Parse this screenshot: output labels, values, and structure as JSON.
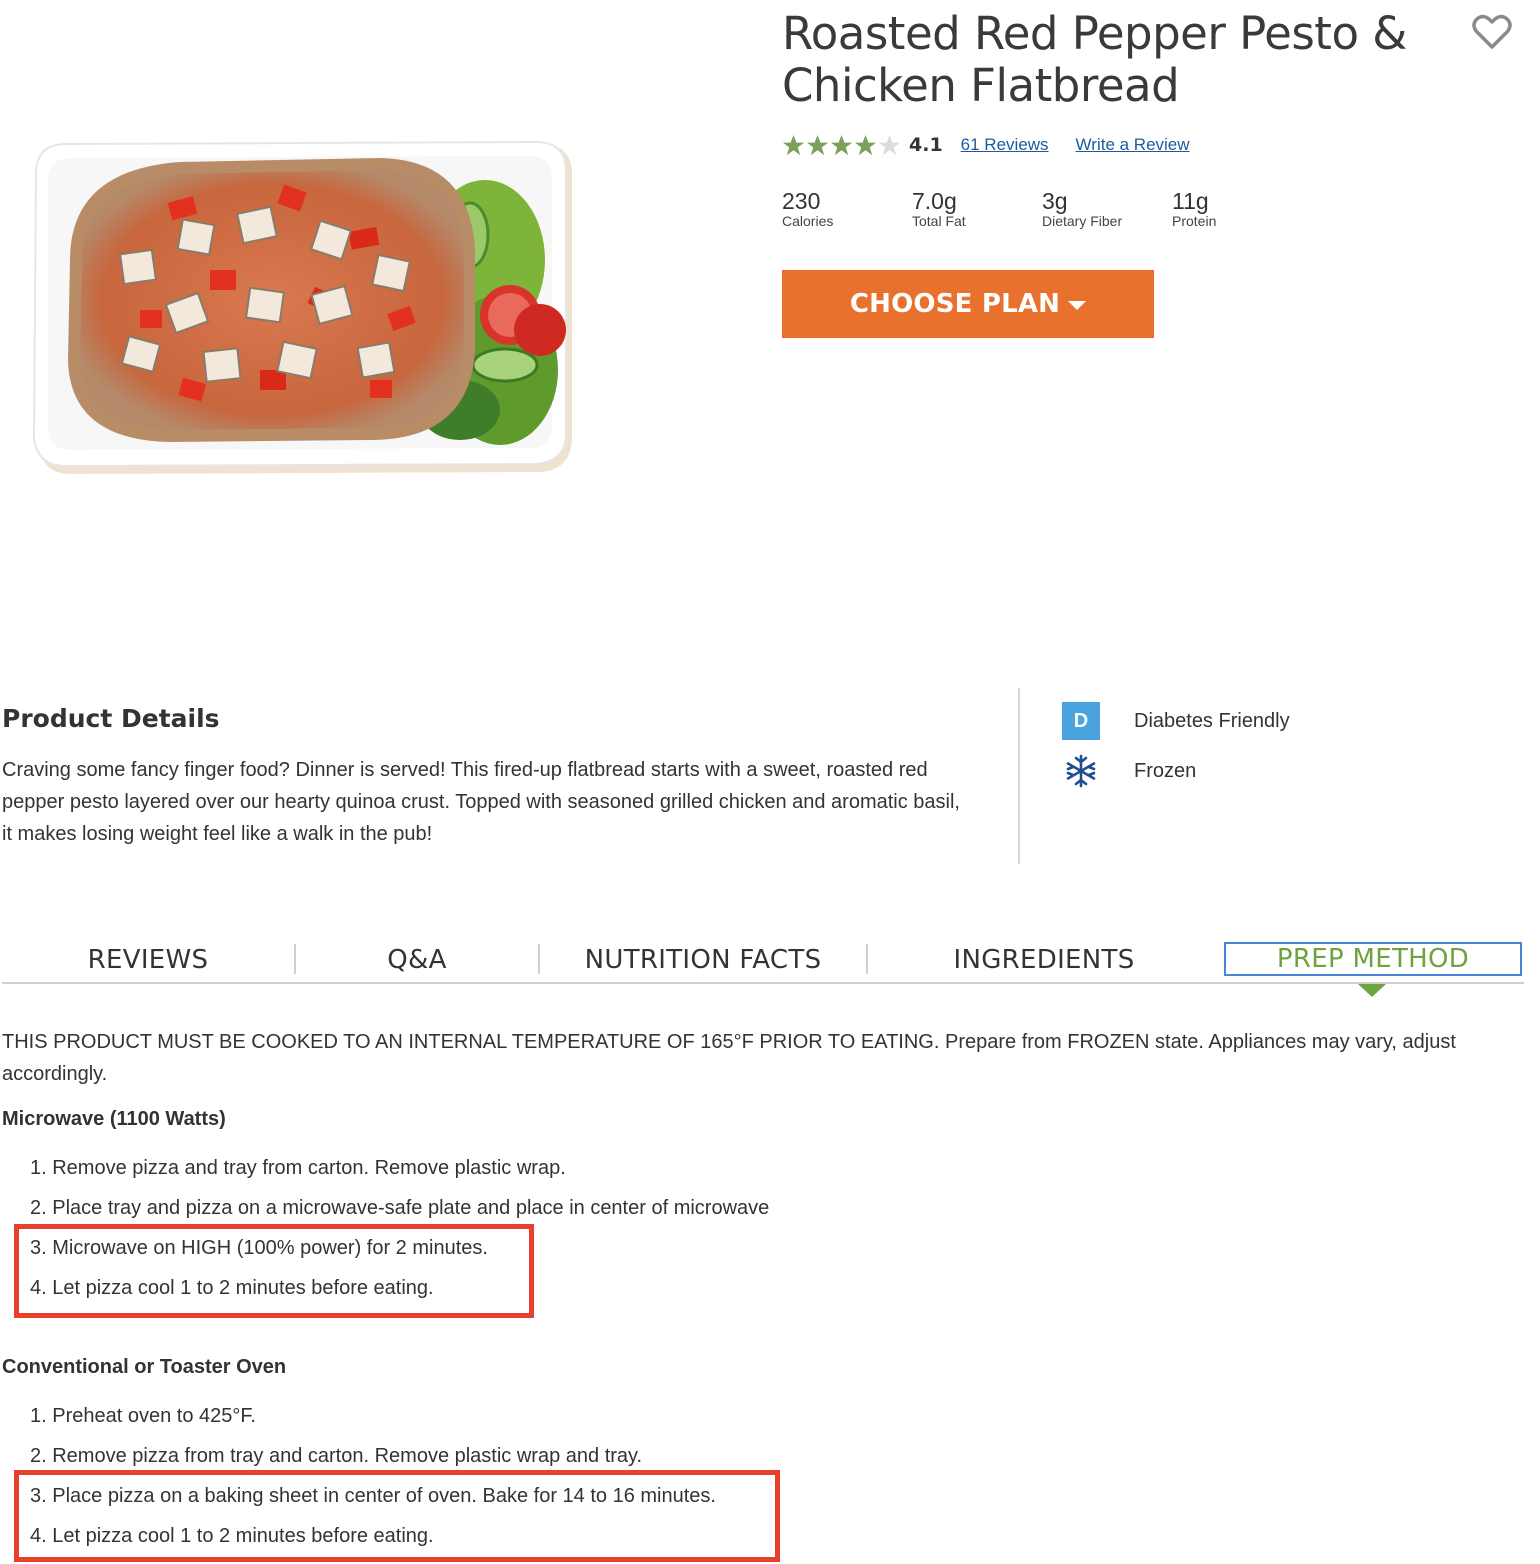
{
  "product": {
    "title": "Roasted Red Pepper Pesto & Chicken Flatbread",
    "rating": "4.1",
    "rating_stars": 4.1,
    "reviews_link": "61 Reviews",
    "write_review_link": "Write a Review"
  },
  "nutrients": [
    {
      "value": "230",
      "label": "Calories"
    },
    {
      "value": "7.0g",
      "label": "Total Fat"
    },
    {
      "value": "3g",
      "label": "Dietary Fiber"
    },
    {
      "value": "11g",
      "label": "Protein"
    }
  ],
  "cta": {
    "label": "CHOOSE PLAN"
  },
  "details": {
    "heading": "Product Details",
    "description": "Craving some fancy finger food? Dinner is served! This fired-up flatbread starts with a sweet, roasted red pepper pesto layered over our hearty quinoa crust. Topped with seasoned grilled chicken and aromatic basil, it makes losing weight feel like a walk in the pub!",
    "attributes": [
      {
        "badge": "D",
        "label": "Diabetes Friendly",
        "icon": "diabetes-badge-icon"
      },
      {
        "badge": "",
        "label": "Frozen",
        "icon": "snowflake-icon"
      }
    ]
  },
  "tabs": [
    "REVIEWS",
    "Q&A",
    "NUTRITION FACTS",
    "INGREDIENTS",
    "PREP METHOD"
  ],
  "active_tab": "PREP METHOD",
  "prep": {
    "intro": "THIS PRODUCT MUST BE COOKED TO AN INTERNAL TEMPERATURE OF 165°F PRIOR TO EATING. Prepare from FROZEN state. Appliances may vary, adjust accordingly.",
    "microwave": {
      "title": "Microwave (1100 Watts)",
      "steps": [
        "1. Remove pizza and tray from carton. Remove plastic wrap.",
        "2. Place tray and pizza on a microwave-safe plate and place in center of microwave",
        "3. Microwave on HIGH (100% power) for 2 minutes.",
        "4. Let pizza cool 1 to 2 minutes before eating."
      ]
    },
    "oven": {
      "title": "Conventional or Toaster Oven",
      "steps": [
        "1. Preheat oven to 425°F.",
        "2. Remove pizza from tray and carton. Remove plastic wrap and tray.",
        "3. Place pizza on a baking sheet in center of oven. Bake for 14 to 16 minutes.",
        "4. Let pizza cool 1 to 2 minutes before eating."
      ]
    }
  },
  "colors": {
    "accent_orange": "#e8722d",
    "star_green": "#7ba05b",
    "active_tab_green": "#6ea43c",
    "link_blue": "#1c5b9c",
    "highlight_red": "#e8402a"
  }
}
